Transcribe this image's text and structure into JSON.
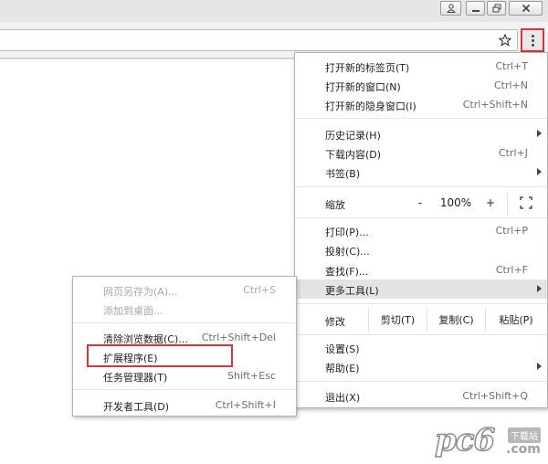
{
  "main_menu": {
    "items": [
      {
        "label": "打开新的标签页(T)",
        "shortcut": "Ctrl+T"
      },
      {
        "label": "打开新的窗口(N)",
        "shortcut": "Ctrl+N"
      },
      {
        "label": "打开新的隐身窗口(I)",
        "shortcut": "Ctrl+Shift+N"
      },
      {
        "label": "历史记录(H)",
        "shortcut": ""
      },
      {
        "label": "下载内容(D)",
        "shortcut": "Ctrl+J"
      },
      {
        "label": "书签(B)",
        "shortcut": ""
      },
      {
        "label": "打印(P)...",
        "shortcut": "Ctrl+P"
      },
      {
        "label": "投射(C)...",
        "shortcut": ""
      },
      {
        "label": "查找(F)...",
        "shortcut": "Ctrl+F"
      },
      {
        "label": "更多工具(L)",
        "shortcut": ""
      },
      {
        "label": "设置(S)",
        "shortcut": ""
      },
      {
        "label": "帮助(E)",
        "shortcut": ""
      },
      {
        "label": "退出(X)",
        "shortcut": "Ctrl+Shift+Q"
      }
    ],
    "zoom": {
      "label": "缩放",
      "minus": "-",
      "value": "100%",
      "plus": "+"
    },
    "edit": {
      "label": "修改",
      "cut": "剪切(T)",
      "copy": "复制(C)",
      "paste": "粘贴(P)"
    }
  },
  "sub_menu": {
    "items": [
      {
        "label": "网页另存为(A)...",
        "shortcut": "Ctrl+S"
      },
      {
        "label": "添加到桌面...",
        "shortcut": ""
      },
      {
        "label": "清除浏览数据(C)...",
        "shortcut": "Ctrl+Shift+Del"
      },
      {
        "label": "扩展程序(E)",
        "shortcut": ""
      },
      {
        "label": "任务管理器(T)",
        "shortcut": "Shift+Esc"
      },
      {
        "label": "开发者工具(D)",
        "shortcut": "Ctrl+Shift+I"
      }
    ]
  },
  "watermark": {
    "text": "pc6",
    "badge": "下载站",
    "domain": ".com"
  },
  "colors": {
    "highlight_red": "#d9343a",
    "hover_gray": "#e3e3e3"
  },
  "icons": [
    "user-icon",
    "minimize-icon",
    "restore-icon",
    "close-icon",
    "star-icon",
    "menu-icon",
    "fullscreen-icon",
    "submenu-arrow-icon"
  ]
}
